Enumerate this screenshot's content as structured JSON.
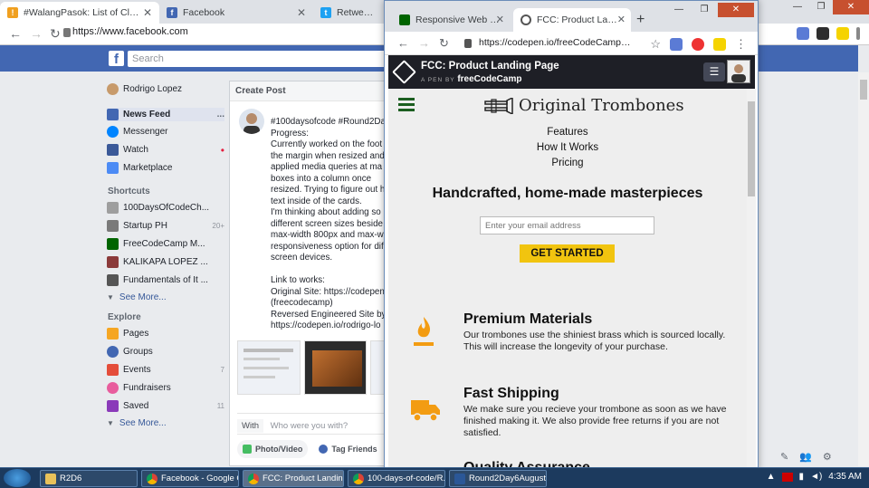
{
  "back_browser": {
    "tabs": [
      {
        "title": "#WalangPasok: List of Class susp",
        "icon": "warning-icon"
      },
      {
        "title": "Facebook",
        "icon": "facebook-icon"
      },
      {
        "title": "Retweeted / T",
        "icon": "twitter-icon"
      }
    ],
    "url": "https://www.facebook.com"
  },
  "facebook": {
    "search_placeholder": "Search",
    "profile_name": "Rodrigo Lopez",
    "sidebar": [
      {
        "label": "News Feed",
        "badge": "..."
      },
      {
        "label": "Messenger",
        "badge": ""
      },
      {
        "label": "Watch",
        "badge": "•"
      },
      {
        "label": "Marketplace",
        "badge": ""
      }
    ],
    "shortcuts_heading": "Shortcuts",
    "shortcuts": [
      {
        "label": "100DaysOfCodeCh...",
        "badge": ""
      },
      {
        "label": "Startup PH",
        "badge": "20+"
      },
      {
        "label": "FreeCodeCamp M...",
        "badge": ""
      },
      {
        "label": "KALIKAPA LOPEZ ...",
        "badge": ""
      },
      {
        "label": "Fundamentals of It ...",
        "badge": ""
      }
    ],
    "see_more": "See More...",
    "explore_heading": "Explore",
    "explore": [
      {
        "label": "Pages",
        "badge": ""
      },
      {
        "label": "Groups",
        "badge": ""
      },
      {
        "label": "Events",
        "badge": "7"
      },
      {
        "label": "Fundraisers",
        "badge": ""
      },
      {
        "label": "Saved",
        "badge": "11"
      }
    ],
    "create_post": {
      "title": "Create Post",
      "text": "#100daysofcode #Round2Da\nProgress:\nCurrently worked on the foot\nthe margin when resized and\napplied media queries at ma\nboxes into a column once\nresized. Trying to figure out h\ntext inside of the cards.\nI'm thinking about adding so\ndifferent screen sizes beside\nmax-width 800px and max-w\nresponsiveness option for dif\nscreen devices.\n\nLink to works:\nOriginal Site: https://codepen\n(freecodecamp)\nReversed Engineered Site by\nhttps://codepen.io/rodrigo-lo",
      "with_label": "With",
      "with_placeholder": "Who were you with?",
      "photo_video": "Photo/Video",
      "tag_friends": "Tag Friends"
    }
  },
  "front_browser": {
    "tabs": [
      {
        "title": "Responsive Web Desig"
      },
      {
        "title": "FCC: Product Landing P"
      }
    ],
    "url": "https://codepen.io/freeCodeCamp/fu...",
    "codepen_title": "FCC: Product Landing Page",
    "codepen_by": "A PEN BY",
    "codepen_author": "freeCodeCamp"
  },
  "landing": {
    "brand": "Original Trombones",
    "nav": [
      "Features",
      "How It Works",
      "Pricing"
    ],
    "hero_heading": "Handcrafted, home-made masterpieces",
    "email_placeholder": "Enter your email address",
    "cta": "GET STARTED",
    "features": [
      {
        "title": "Premium Materials",
        "icon": "fire-icon",
        "text": "Our trombones use the shiniest brass which is sourced locally. This will increase the longevity of your purchase."
      },
      {
        "title": "Fast Shipping",
        "icon": "truck-icon",
        "text": "We make sure you recieve your trombone as soon as we have finished making it. We also provide free returns if you are not satisfied."
      },
      {
        "title": "Quality Assurance",
        "icon": "",
        "text": ""
      }
    ],
    "accent_color": "#f1c40f",
    "icon_color": "#f39c12"
  },
  "taskbar": {
    "items": [
      {
        "label": "R2D6"
      },
      {
        "label": "Facebook - Google C..."
      },
      {
        "label": "FCC: Product Landin..."
      },
      {
        "label": "100-days-of-code/R..."
      },
      {
        "label": "Round2Day6August9..."
      }
    ],
    "time": "4:35 AM"
  }
}
